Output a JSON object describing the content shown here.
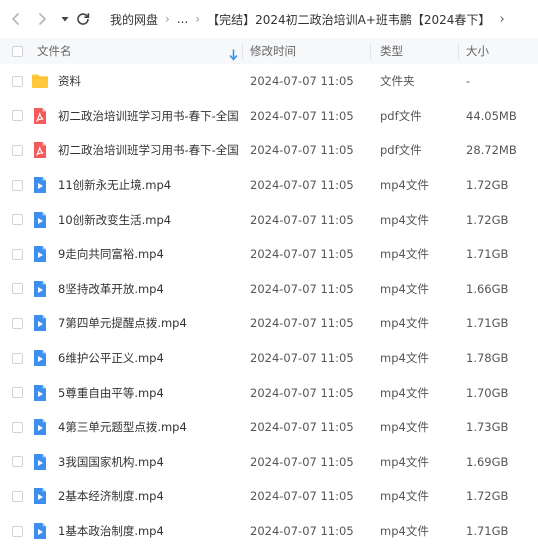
{
  "breadcrumb": {
    "root": "我的网盘",
    "ellipsis": "...",
    "current": "【完结】2024初二政治培训A+班韦鹏【2024春下】"
  },
  "header": {
    "name": "文件名",
    "time": "修改时间",
    "type": "类型",
    "size": "大小",
    "sort_icon": "arrow-down-icon"
  },
  "rows": [
    {
      "icon": "folder-icon",
      "name": "资料",
      "time": "2024-07-07 11:05",
      "type": "文件夹",
      "size": "-"
    },
    {
      "icon": "pdf-icon",
      "name": "初二政治培训班学习用书-春下-全国...",
      "time": "2024-07-07 11:05",
      "type": "pdf文件",
      "size": "44.05MB"
    },
    {
      "icon": "pdf-icon",
      "name": "初二政治培训班学习用书-春下-全国...",
      "time": "2024-07-07 11:05",
      "type": "pdf文件",
      "size": "28.72MB"
    },
    {
      "icon": "video-icon",
      "name": "11创新永无止境.mp4",
      "time": "2024-07-07 11:05",
      "type": "mp4文件",
      "size": "1.72GB"
    },
    {
      "icon": "video-icon",
      "name": "10创新改变生活.mp4",
      "time": "2024-07-07 11:05",
      "type": "mp4文件",
      "size": "1.72GB"
    },
    {
      "icon": "video-icon",
      "name": "9走向共同富裕.mp4",
      "time": "2024-07-07 11:05",
      "type": "mp4文件",
      "size": "1.71GB"
    },
    {
      "icon": "video-icon",
      "name": "8坚持改革开放.mp4",
      "time": "2024-07-07 11:05",
      "type": "mp4文件",
      "size": "1.66GB"
    },
    {
      "icon": "video-icon",
      "name": "7第四单元提醒点拨.mp4",
      "time": "2024-07-07 11:05",
      "type": "mp4文件",
      "size": "1.71GB"
    },
    {
      "icon": "video-icon",
      "name": "6维护公平正义.mp4",
      "time": "2024-07-07 11:05",
      "type": "mp4文件",
      "size": "1.78GB"
    },
    {
      "icon": "video-icon",
      "name": "5尊重自由平等.mp4",
      "time": "2024-07-07 11:05",
      "type": "mp4文件",
      "size": "1.70GB"
    },
    {
      "icon": "video-icon",
      "name": "4第三单元题型点拨.mp4",
      "time": "2024-07-07 11:05",
      "type": "mp4文件",
      "size": "1.73GB"
    },
    {
      "icon": "video-icon",
      "name": "3我国国家机构.mp4",
      "time": "2024-07-07 11:05",
      "type": "mp4文件",
      "size": "1.69GB"
    },
    {
      "icon": "video-icon",
      "name": "2基本经济制度.mp4",
      "time": "2024-07-07 11:05",
      "type": "mp4文件",
      "size": "1.72GB"
    },
    {
      "icon": "video-icon",
      "name": "1基本政治制度.mp4",
      "time": "2024-07-07 11:05",
      "type": "mp4文件",
      "size": "1.71GB"
    }
  ],
  "colors": {
    "accent": "#2f8fef",
    "pdf": "#f45a5a",
    "folder": "#ffc83d",
    "video": "#3c8ef0",
    "header_bg": "#f7f8fa"
  }
}
